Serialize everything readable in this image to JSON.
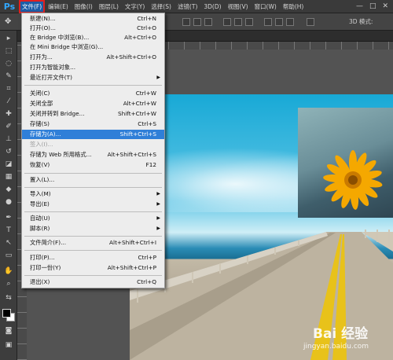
{
  "menubar": {
    "logo": "Ps",
    "items": [
      {
        "label": "文件(F)"
      },
      {
        "label": "编辑(E)"
      },
      {
        "label": "图像(I)"
      },
      {
        "label": "图层(L)"
      },
      {
        "label": "文字(Y)"
      },
      {
        "label": "选择(S)"
      },
      {
        "label": "滤镜(T)"
      },
      {
        "label": "3D(D)"
      },
      {
        "label": "视图(V)"
      },
      {
        "label": "窗口(W)"
      },
      {
        "label": "帮助(H)"
      }
    ],
    "window_controls": [
      "—",
      "□",
      "✕"
    ]
  },
  "options_bar": {
    "mode_label": "3D 模式:"
  },
  "file_menu": {
    "items": [
      {
        "label": "新建(N)...",
        "shortcut": "Ctrl+N"
      },
      {
        "label": "打开(O)...",
        "shortcut": "Ctrl+O"
      },
      {
        "label": "在 Bridge 中浏览(B)...",
        "shortcut": "Alt+Ctrl+O"
      },
      {
        "label": "在 Mini Bridge 中浏览(G)...",
        "shortcut": ""
      },
      {
        "label": "打开为...",
        "shortcut": "Alt+Shift+Ctrl+O"
      },
      {
        "label": "打开为智能对象...",
        "shortcut": ""
      },
      {
        "label": "最近打开文件(T)",
        "shortcut": "",
        "submenu": true
      },
      {
        "label": "关闭(C)",
        "shortcut": "Ctrl+W"
      },
      {
        "label": "关闭全部",
        "shortcut": "Alt+Ctrl+W"
      },
      {
        "label": "关闭并转到 Bridge...",
        "shortcut": "Shift+Ctrl+W"
      },
      {
        "label": "存储(S)",
        "shortcut": "Ctrl+S"
      },
      {
        "label": "存储为(A)...",
        "shortcut": "Shift+Ctrl+S",
        "highlighted": true
      },
      {
        "label": "签入(I)...",
        "shortcut": "",
        "disabled": true
      },
      {
        "label": "存储为 Web 所用格式...",
        "shortcut": "Alt+Shift+Ctrl+S"
      },
      {
        "label": "恢复(V)",
        "shortcut": "F12"
      },
      {
        "label": "置入(L)...",
        "shortcut": ""
      },
      {
        "label": "导入(M)",
        "shortcut": "",
        "submenu": true
      },
      {
        "label": "导出(E)",
        "shortcut": "",
        "submenu": true
      },
      {
        "label": "自动(U)",
        "shortcut": "",
        "submenu": true
      },
      {
        "label": "脚本(R)",
        "shortcut": "",
        "submenu": true
      },
      {
        "label": "文件简介(F)...",
        "shortcut": "Alt+Shift+Ctrl+I"
      },
      {
        "label": "打印(P)...",
        "shortcut": "Ctrl+P"
      },
      {
        "label": "打印一份(Y)",
        "shortcut": "Alt+Shift+Ctrl+P"
      },
      {
        "label": "退出(X)",
        "shortcut": "Ctrl+Q"
      }
    ]
  },
  "watermark": {
    "brand": "Bai 经验",
    "url": "jingyan.baidu.com"
  },
  "colors": {
    "menu_highlight": "#2f7fd8",
    "active_menu_outline": "#e02020",
    "ps_blue": "#31a8ff"
  }
}
